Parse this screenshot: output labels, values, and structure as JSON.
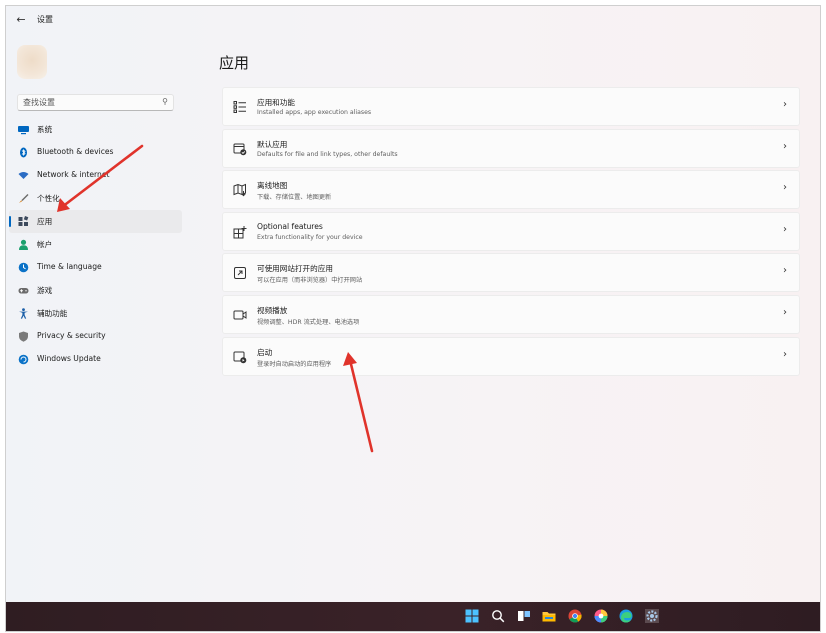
{
  "window": {
    "title": "设置",
    "back_icon": "arrow-left-icon"
  },
  "search": {
    "placeholder": "查找设置",
    "icon": "search-icon"
  },
  "sidebar": {
    "items": [
      {
        "label": "系统",
        "icon": "monitor-icon",
        "color": "#0067c0"
      },
      {
        "label": "Bluetooth & devices",
        "icon": "bluetooth-icon",
        "color": "#0067c0"
      },
      {
        "label": "Network & internet",
        "icon": "wifi-icon",
        "color": "#2b6cc4"
      },
      {
        "label": "个性化",
        "icon": "brush-icon",
        "color": "#d98a2b"
      },
      {
        "label": "应用",
        "icon": "apps-icon",
        "color": "#3d4a5c",
        "active": true
      },
      {
        "label": "帐户",
        "icon": "person-icon",
        "color": "#1aa06d"
      },
      {
        "label": "Time & language",
        "icon": "globe-clock-icon",
        "color": "#0b72c7"
      },
      {
        "label": "游戏",
        "icon": "gamepad-icon",
        "color": "#6b6b6b"
      },
      {
        "label": "辅助功能",
        "icon": "accessibility-icon",
        "color": "#1b5fa8"
      },
      {
        "label": "Privacy & security",
        "icon": "shield-icon",
        "color": "#7a7a7a"
      },
      {
        "label": "Windows Update",
        "icon": "update-icon",
        "color": "#0b72c7"
      }
    ]
  },
  "main": {
    "title": "应用",
    "cards": [
      {
        "title": "应用和功能",
        "subtitle": "Installed apps, app execution aliases",
        "icon": "apps-list-icon"
      },
      {
        "title": "默认应用",
        "subtitle": "Defaults for file and link types, other defaults",
        "icon": "default-apps-icon"
      },
      {
        "title": "离线地图",
        "subtitle": "下载、存储位置、地图更新",
        "icon": "offline-map-icon"
      },
      {
        "title": "Optional features",
        "subtitle": "Extra functionality for your device",
        "icon": "optional-features-icon"
      },
      {
        "title": "可使用网站打开的应用",
        "subtitle": "可以在应用（而非浏览器）中打开网站",
        "icon": "apps-for-websites-icon"
      },
      {
        "title": "视频播放",
        "subtitle": "视频调整、HDR 流式处理、电池选项",
        "icon": "video-playback-icon"
      },
      {
        "title": "启动",
        "subtitle": "登录时自动启动的应用程序",
        "icon": "startup-icon"
      }
    ],
    "chevron": "chevron-right-icon"
  },
  "taskbar": {
    "icons": [
      "windows-start-icon",
      "search-icon",
      "task-view-icon",
      "file-explorer-icon",
      "chrome-icon",
      "colorful-app-icon",
      "edge-browser-icon",
      "settings-gear-icon"
    ]
  },
  "annotations": {
    "arrow_color": "#e0332b"
  }
}
